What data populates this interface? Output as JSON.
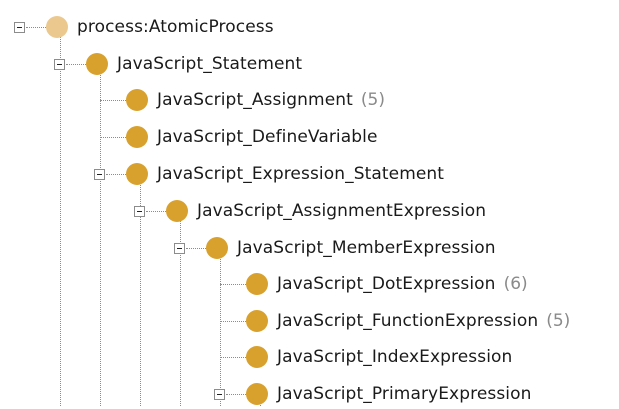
{
  "tree": {
    "root": {
      "label": "process:AtomicProcess",
      "icon": "class-icon-light",
      "expanded": true
    },
    "statement": {
      "label": "JavaScript_Statement",
      "icon": "class-icon",
      "expanded": true
    },
    "assignment": {
      "label": "JavaScript_Assignment",
      "count": "(5)",
      "icon": "class-icon"
    },
    "define_variable": {
      "label": "JavaScript_DefineVariable",
      "icon": "class-icon"
    },
    "expression_statement": {
      "label": "JavaScript_Expression_Statement",
      "icon": "class-icon",
      "expanded": true
    },
    "assignment_expression": {
      "label": "JavaScript_AssignmentExpression",
      "icon": "class-icon",
      "expanded": true
    },
    "member_expression": {
      "label": "JavaScript_MemberExpression",
      "icon": "class-icon",
      "expanded": true
    },
    "dot_expression": {
      "label": "JavaScript_DotExpression",
      "count": "(6)",
      "icon": "class-icon"
    },
    "function_expression": {
      "label": "JavaScript_FunctionExpression",
      "count": "(5)",
      "icon": "class-icon"
    },
    "index_expression": {
      "label": "JavaScript_IndexExpression",
      "icon": "class-icon"
    },
    "primary_expression": {
      "label": "JavaScript_PrimaryExpression",
      "icon": "class-icon",
      "expanded": true
    }
  },
  "colors": {
    "class_dot": "#d8a12e",
    "class_dot_light": "#ebc98e",
    "count_text": "#8a8a8a",
    "tree_lines": "#8c8c8c"
  }
}
